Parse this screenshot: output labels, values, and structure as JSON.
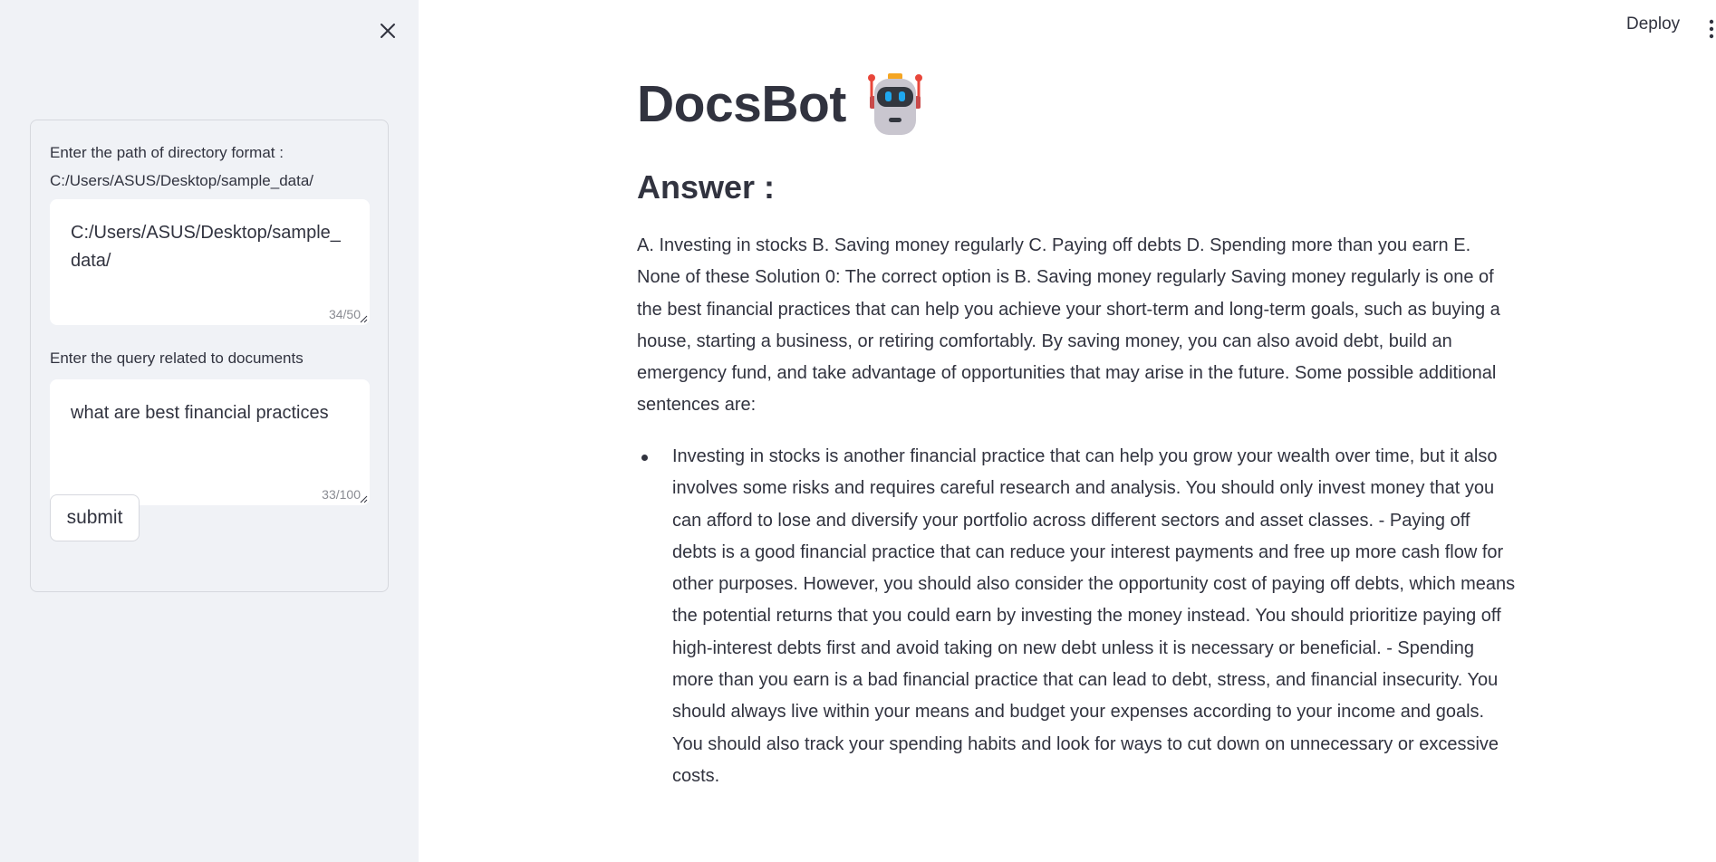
{
  "sidebar": {
    "close_icon": "close-icon",
    "directory_label": "Enter the path of directory format : C:/Users/ASUS/Desktop/sample_data/",
    "directory_value": "C:/Users/ASUS/Desktop/sample_ data/",
    "directory_counter": "34/50",
    "query_label": "Enter the query related to documents",
    "query_value": "what are best financial practices",
    "query_counter": "33/100",
    "submit_label": "submit"
  },
  "header": {
    "deploy_label": "Deploy",
    "menu_icon": "kebab-menu-icon"
  },
  "main": {
    "title": "DocsBot",
    "title_icon": "robot-icon",
    "answer_heading": "Answer :",
    "answer_text": "A. Investing in stocks B. Saving money regularly C. Paying off debts D. Spending more than you earn E. None of these Solution 0: The correct option is B. Saving money regularly Saving money regularly is one of the best financial practices that can help you achieve your short-term and long-term goals, such as buying a house, starting a business, or retiring comfortably. By saving money, you can also avoid debt, build an emergency fund, and take advantage of opportunities that may arise in the future. Some possible additional sentences are:",
    "bullets": [
      "Investing in stocks is another financial practice that can help you grow your wealth over time, but it also involves some risks and requires careful research and analysis. You should only invest money that you can afford to lose and diversify your portfolio across different sectors and asset classes. - Paying off debts is a good financial practice that can reduce your interest payments and free up more cash flow for other purposes. However, you should also consider the opportunity cost of paying off debts, which means the potential returns that you could earn by investing the money instead. You should prioritize paying off high-interest debts first and avoid taking on new debt unless it is necessary or beneficial. - Spending more than you earn is a bad financial practice that can lead to debt, stress, and financial insecurity. You should always live within your means and budget your expenses according to your income and goals. You should also track your spending habits and look for ways to cut down on unnecessary or excessive costs."
    ]
  },
  "colors": {
    "sidebar_bg": "#f0f2f6",
    "text": "#31333f",
    "robot_antenna": "#e8463a",
    "robot_eyes": "#1fa8f0"
  }
}
